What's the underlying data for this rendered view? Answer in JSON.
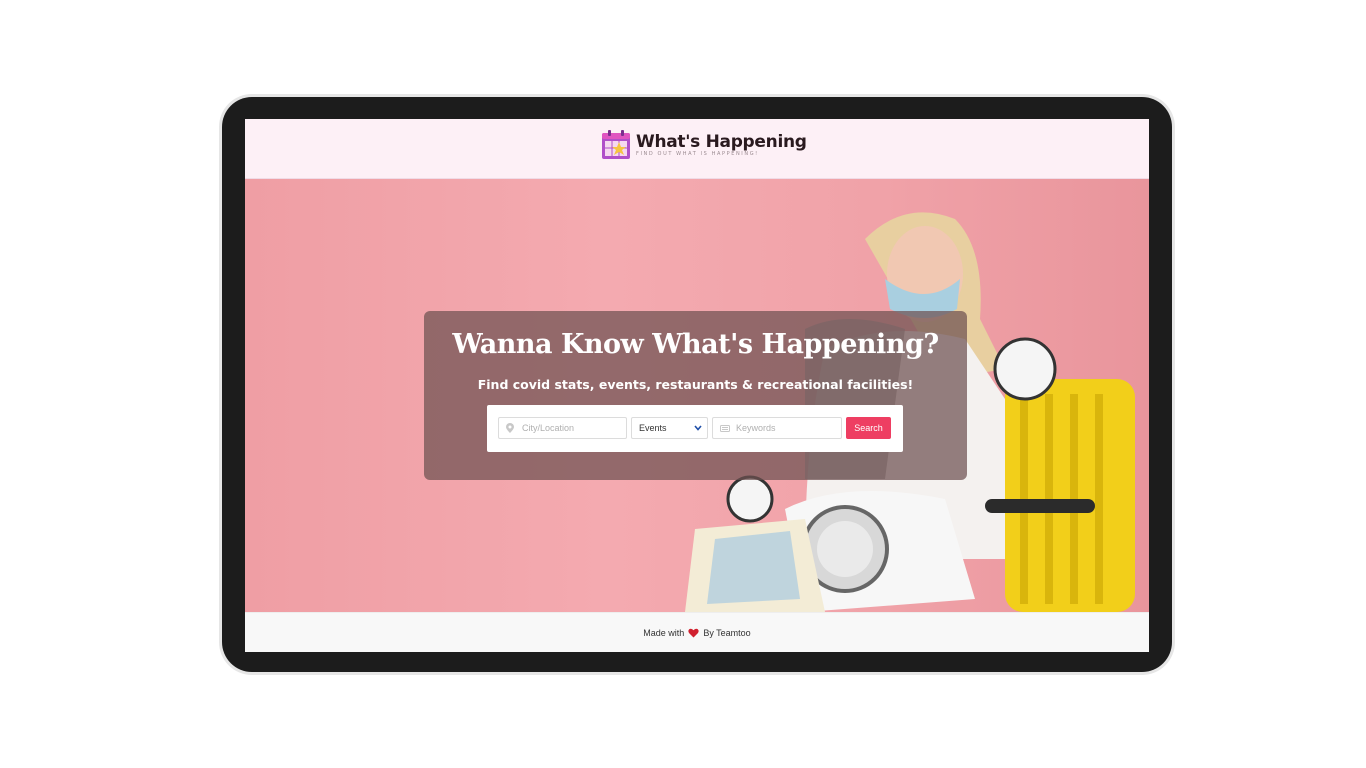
{
  "header": {
    "logo_title": "What's Happening",
    "logo_tagline": "FIND OUT WHAT IS HAPPENING!"
  },
  "hero": {
    "title": "Wanna Know What's Happening?",
    "subtitle": "Find covid stats, events, restaurants & recreational facilities!"
  },
  "search": {
    "city_placeholder": "City/Location",
    "category_selected": "Events",
    "keywords_placeholder": "Keywords",
    "button_label": "Search"
  },
  "footer": {
    "made_with": "Made with",
    "by": "By Teamtoo"
  },
  "colors": {
    "accent": "#ee3e62",
    "hero_bg": "#f4aab0",
    "header_bg": "#fdf0f6"
  }
}
